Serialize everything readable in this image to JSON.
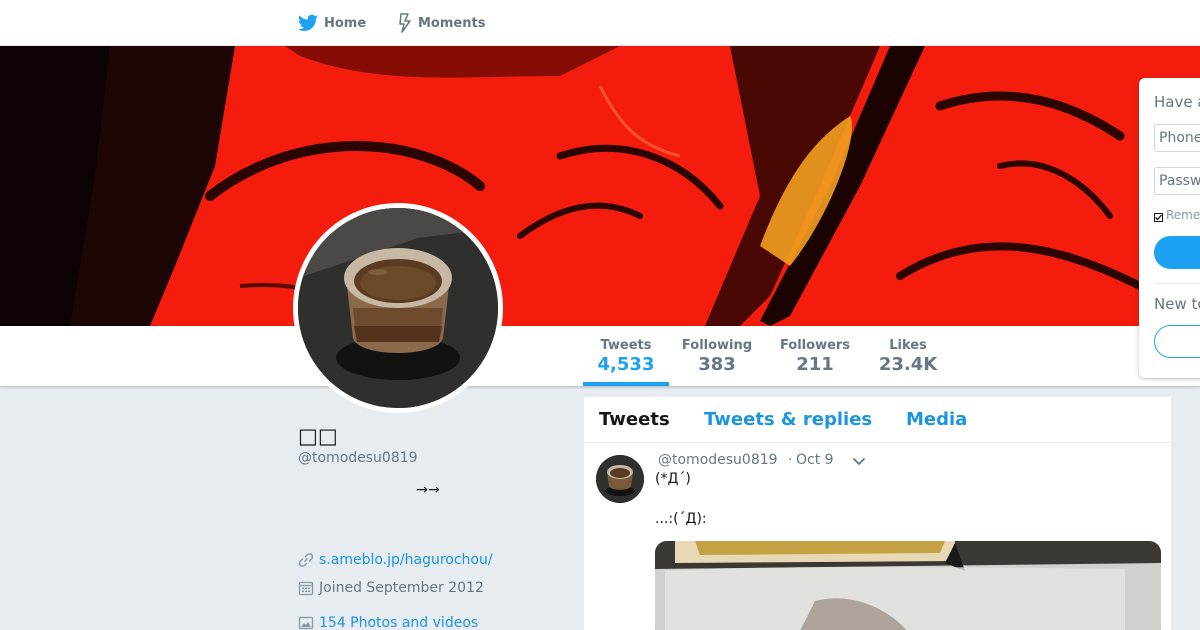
{
  "nav": {
    "home_label": "Home",
    "moments_label": "Moments"
  },
  "profile": {
    "display_name": "□□",
    "screen_name": "@tomodesu0819",
    "bio": "→→",
    "url": "s.ameblo.jp/hagurochou/",
    "joined": "Joined September 2012",
    "photos": "154 Photos and videos"
  },
  "stats": [
    {
      "label": "Tweets",
      "value": "4,533",
      "active": true
    },
    {
      "label": "Following",
      "value": "383",
      "active": false
    },
    {
      "label": "Followers",
      "value": "211",
      "active": false
    },
    {
      "label": "Likes",
      "value": "23.4K",
      "active": false
    }
  ],
  "timeline": {
    "tabs": [
      {
        "label": "Tweets",
        "active": true
      },
      {
        "label": "Tweets & replies",
        "active": false
      },
      {
        "label": "Media",
        "active": false
      }
    ],
    "tweet": {
      "handle": "@tomodesu0819",
      "dot": "·",
      "time": "Oct 9",
      "line1": "(*Д´)",
      "line2": "...:(´Д):"
    }
  },
  "login": {
    "title": "Have a",
    "phone_placeholder": "Phone",
    "password_placeholder": "Passw",
    "remember_label": "Reme",
    "new_to": "New to"
  },
  "colors": {
    "accent": "#1da1f2",
    "link": "#1b95e0",
    "banner_red": "#f41c0c",
    "page_bg": "#e6ecf0"
  },
  "icons": {
    "home": "twitter-bird-icon",
    "moments": "lightning-icon",
    "url": "link-icon",
    "joined": "calendar-icon",
    "photos": "image-icon",
    "caret": "chevron-down-icon"
  }
}
